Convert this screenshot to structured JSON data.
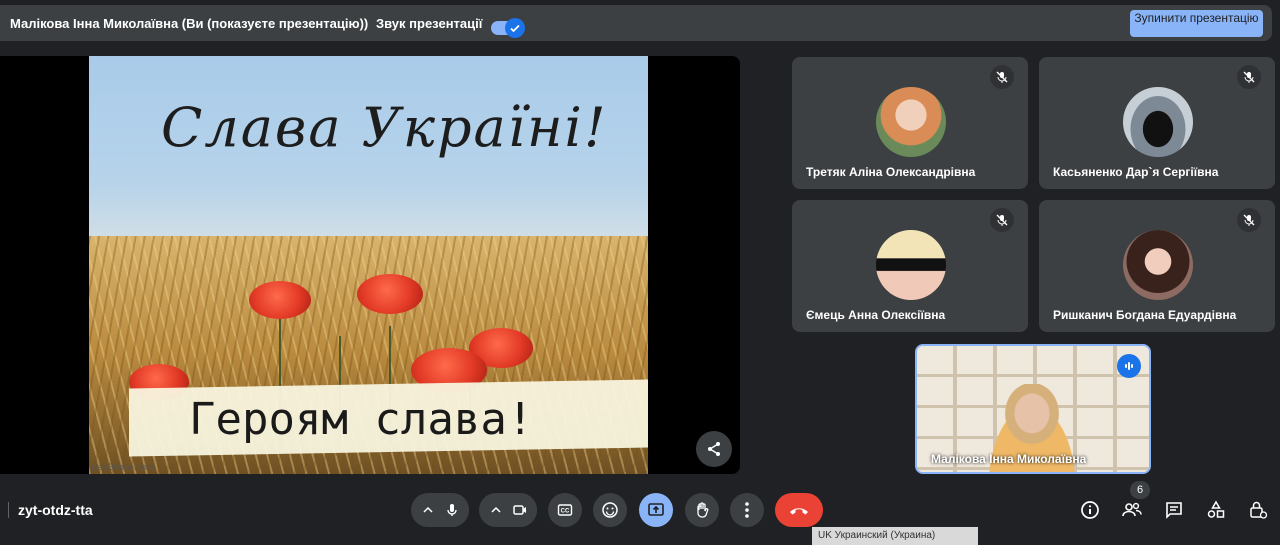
{
  "topbar": {
    "presenter_text": "Малікова Інна Миколаївна (Ви (показуєте презентацію))",
    "sound_label": "Звук презентації",
    "stop_button_label": "Зупинити презентацію",
    "sound_on": true
  },
  "slide": {
    "title": "Слава Україні!",
    "subtitle": "Героям слава!",
    "watermark": "planBeboo.com"
  },
  "participants": [
    {
      "name": "Третяк Аліна Олександрівна",
      "muted": true
    },
    {
      "name": "Касьяненко Дар`я Сергіївна",
      "muted": true
    },
    {
      "name": "Ємець Анна Олексіївна",
      "muted": true
    },
    {
      "name": "Ришканич Богдана Едуардівна",
      "muted": true
    }
  ],
  "self_view": {
    "name": "Малікова Інна Миколаївна",
    "speaking": true
  },
  "bottombar": {
    "meeting_code": "zyt-otdz-tta",
    "participants_count": "6",
    "language_indicator": "UK Украинский (Украина)"
  },
  "icons": [
    "mic-off-icon",
    "share-icon",
    "mic-icon",
    "camera-icon",
    "captions-icon",
    "emoji-icon",
    "present-icon",
    "hand-icon",
    "more-icon",
    "hangup-icon",
    "info-icon",
    "people-icon",
    "chat-icon",
    "activities-icon",
    "host-controls-icon",
    "chevron-up-icon",
    "check-icon"
  ],
  "colors": {
    "accent": "#8ab4f8",
    "hangup": "#ea4335",
    "panel": "#3c4043",
    "background": "#202124"
  }
}
